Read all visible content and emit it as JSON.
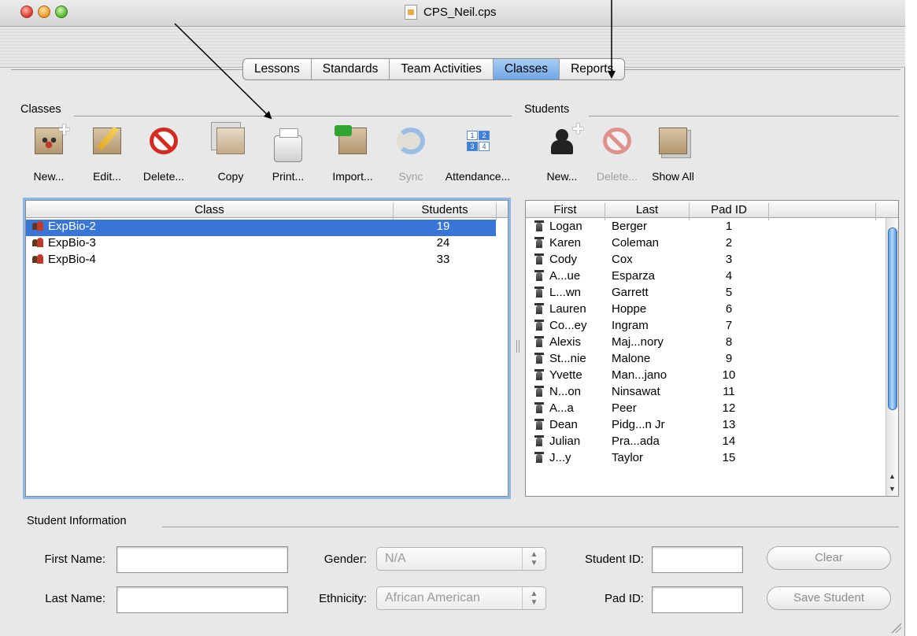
{
  "window": {
    "title": "CPS_Neil.cps"
  },
  "tabs": [
    {
      "label": "Lessons",
      "active": false
    },
    {
      "label": "Standards",
      "active": false
    },
    {
      "label": "Team Activities",
      "active": false
    },
    {
      "label": "Classes",
      "active": true
    },
    {
      "label": "Reports",
      "active": false
    }
  ],
  "classes_section": {
    "label": "Classes",
    "toolbar": [
      {
        "label": "New...",
        "icon": "new-class-icon",
        "enabled": true
      },
      {
        "label": "Edit...",
        "icon": "edit-class-icon",
        "enabled": true
      },
      {
        "label": "Delete...",
        "icon": "delete-icon",
        "enabled": true
      },
      {
        "label": "Copy",
        "icon": "copy-class-icon",
        "enabled": true
      },
      {
        "label": "Print...",
        "icon": "printer-icon",
        "enabled": true
      },
      {
        "label": "Import...",
        "icon": "import-icon",
        "enabled": true
      },
      {
        "label": "Sync",
        "icon": "sync-icon",
        "enabled": false
      },
      {
        "label": "Attendance...",
        "icon": "attendance-icon",
        "enabled": true
      }
    ],
    "columns": [
      "Class",
      "Students"
    ],
    "rows": [
      {
        "name": "ExpBio-2",
        "students": "19",
        "selected": true
      },
      {
        "name": "ExpBio-3",
        "students": "24",
        "selected": false
      },
      {
        "name": "ExpBio-4",
        "students": "33",
        "selected": false
      }
    ]
  },
  "students_section": {
    "label": "Students",
    "toolbar": [
      {
        "label": "New...",
        "icon": "new-student-icon",
        "enabled": true
      },
      {
        "label": "Delete...",
        "icon": "delete-icon",
        "enabled": false
      },
      {
        "label": "Show All",
        "icon": "show-all-icon",
        "enabled": true
      }
    ],
    "columns": [
      "First",
      "Last",
      "Pad ID"
    ],
    "rows": [
      {
        "first": "Logan",
        "last": "Berger",
        "pad": "1"
      },
      {
        "first": "Karen",
        "last": "Coleman",
        "pad": "2"
      },
      {
        "first": "Cody",
        "last": "Cox",
        "pad": "3"
      },
      {
        "first": "A...ue",
        "last": "Esparza",
        "pad": "4"
      },
      {
        "first": "L...wn",
        "last": "Garrett",
        "pad": "5"
      },
      {
        "first": "Lauren",
        "last": "Hoppe",
        "pad": "6"
      },
      {
        "first": "Co...ey",
        "last": "Ingram",
        "pad": "7"
      },
      {
        "first": "Alexis",
        "last": "Maj...nory",
        "pad": "8"
      },
      {
        "first": "St...nie",
        "last": "Malone",
        "pad": "9"
      },
      {
        "first": "Yvette",
        "last": "Man...jano",
        "pad": "10"
      },
      {
        "first": "N...on",
        "last": "Ninsawat",
        "pad": "11"
      },
      {
        "first": "A...a",
        "last": "Peer",
        "pad": "12"
      },
      {
        "first": "Dean",
        "last": "Pidg...n Jr",
        "pad": "13"
      },
      {
        "first": "Julian",
        "last": "Pra...ada",
        "pad": "14"
      },
      {
        "first": "J...y",
        "last": "Taylor",
        "pad": "15"
      }
    ]
  },
  "student_info": {
    "label": "Student Information",
    "first_name_label": "First Name:",
    "first_name_value": "",
    "last_name_label": "Last Name:",
    "last_name_value": "",
    "gender_label": "Gender:",
    "gender_value": "N/A",
    "ethnicity_label": "Ethnicity:",
    "ethnicity_value": "African American",
    "student_id_label": "Student ID:",
    "student_id_value": "",
    "pad_id_label": "Pad ID:",
    "pad_id_value": "",
    "clear_label": "Clear",
    "save_label": "Save Student"
  },
  "colors": {
    "selection": "#3875d7",
    "active_tab": "#6ea6e6",
    "accent_focus": "#8fb7e6"
  }
}
